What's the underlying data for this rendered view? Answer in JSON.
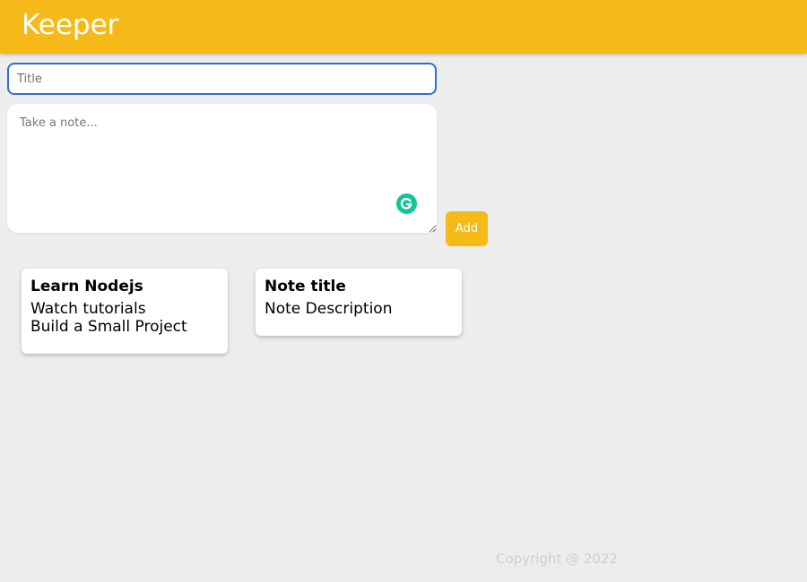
{
  "header": {
    "title": "Keeper"
  },
  "create_note": {
    "title_placeholder": "Title",
    "title_value": "",
    "content_placeholder": "Take a note...",
    "content_value": "",
    "add_label": "Add",
    "grammarly_icon": "grammarly-icon"
  },
  "notes": [
    {
      "title": "Learn Nodejs",
      "content": "Watch tutorials\nBuild a Small Project"
    },
    {
      "title": "Note title",
      "content": "Note Description"
    }
  ],
  "footer": {
    "copyright": "Copyright @ 2022"
  },
  "colors": {
    "brand": "#f5ba18",
    "background": "#ededed",
    "input_focus_border": "#2f6fca",
    "grammarly": "#15c39a"
  }
}
